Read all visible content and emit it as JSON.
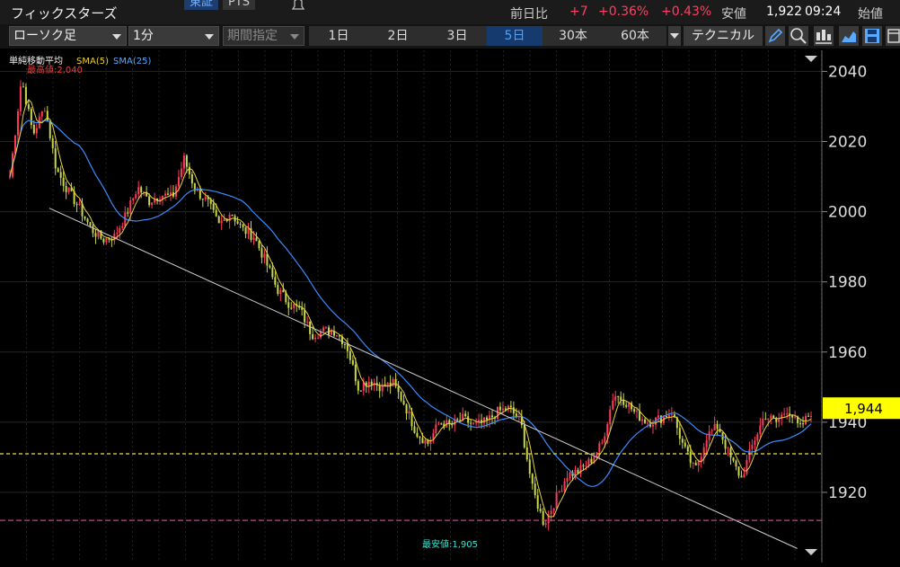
{
  "header": {
    "stock_name": "フィックスターズ",
    "market_tabs": [
      "東証",
      "PTS"
    ],
    "quote": {
      "change_label": "前日比",
      "change": "+7",
      "change_pct1": "+0.36%",
      "change_pct2": "+0.43%",
      "price_label": "安値",
      "price": "1,922",
      "time": "09:24",
      "open_label": "始値"
    }
  },
  "toolbar": {
    "chart_type": "ローソク足",
    "interval": "1分",
    "period_select": "期間指定",
    "periods": [
      "1日",
      "2日",
      "3日",
      "5日",
      "30本",
      "60本"
    ],
    "active_period": "5日",
    "technical": "テクニカル"
  },
  "legend": {
    "title": "単純移動平均",
    "sma5": "SMA(5)",
    "sma25": "SMA(25)",
    "high_label": "最高値:2,040",
    "low_label": "最安値:1,905"
  },
  "axis": {
    "ticks": [
      "2040",
      "2020",
      "2000",
      "1980",
      "1960",
      "1940",
      "1920"
    ],
    "current_price": "1,944"
  },
  "colors": {
    "up": "#ff3b5c",
    "down": "#c8d84a",
    "sma5": "#e8d23a",
    "sma25": "#3a8cff",
    "dashed_yellow": "#f0e040",
    "dashed_magenta": "#d0408a",
    "price_tag": "#ffff00"
  },
  "chart_data": {
    "type": "candlestick",
    "interval": "1分",
    "period": "5日",
    "ylim": [
      1900,
      2046
    ],
    "close_path": [
      2010,
      2038,
      2022,
      2030,
      2012,
      2006,
      2001,
      1995,
      1992,
      1993,
      1999,
      2007,
      2003,
      2005,
      2004,
      2015,
      2006,
      2003,
      1996,
      2000,
      1995,
      1993,
      1986,
      1978,
      1974,
      1972,
      1965,
      1966,
      1966,
      1962,
      1950,
      1952,
      1950,
      1951,
      1945,
      1937,
      1934,
      1940,
      1939,
      1941,
      1939,
      1940,
      1943,
      1944,
      1940,
      1921,
      1911,
      1918,
      1925,
      1926,
      1929,
      1934,
      1948,
      1946,
      1942,
      1940,
      1941,
      1943,
      1933,
      1926,
      1936,
      1939,
      1930,
      1924,
      1934,
      1942,
      1940,
      1944,
      1938,
      1943
    ],
    "horizontal_lines": [
      1931,
      1912
    ],
    "trendline": [
      [
        0.06,
        2001
      ],
      [
        0.97,
        1904
      ]
    ]
  }
}
